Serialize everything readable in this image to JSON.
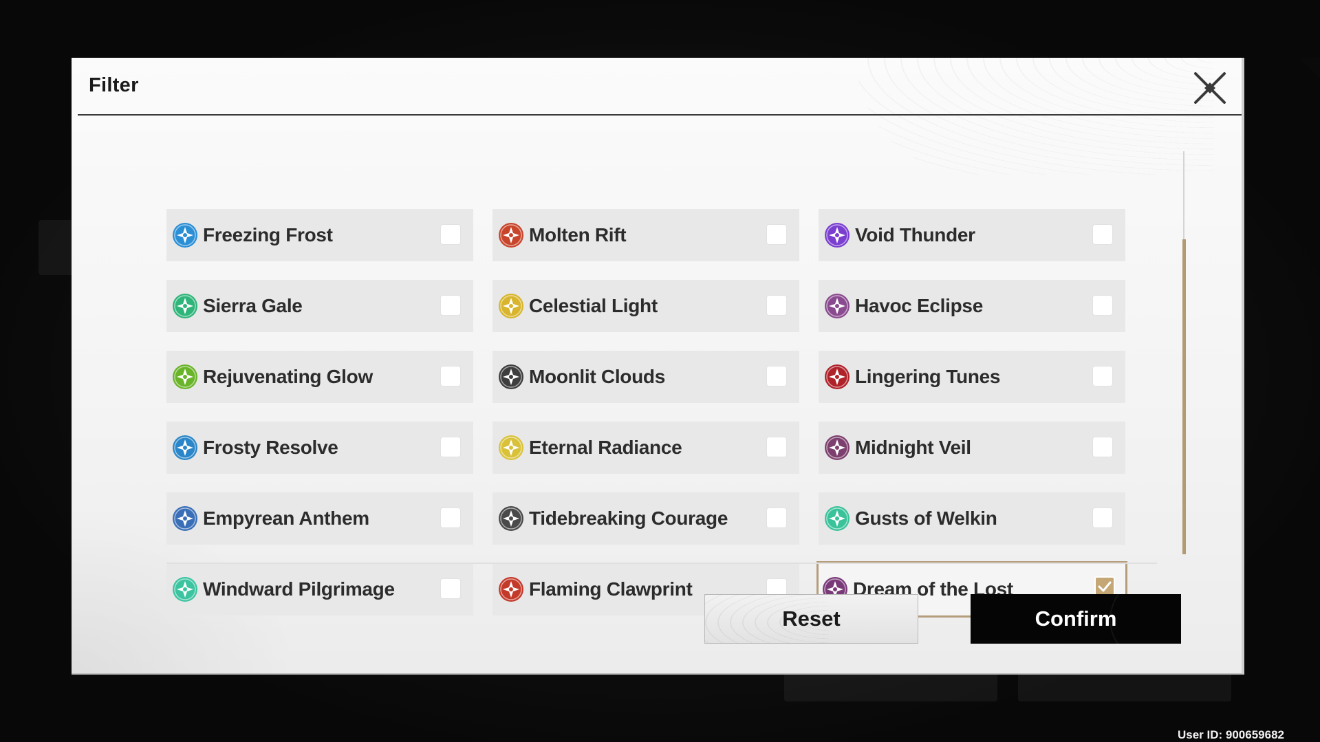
{
  "dialog": {
    "title": "Filter"
  },
  "items": [
    {
      "label": "Freezing Frost",
      "icon": "freezing-frost-icon",
      "color": "#2b8fd6",
      "checked": false
    },
    {
      "label": "Molten Rift",
      "icon": "molten-rift-icon",
      "color": "#c8452b",
      "checked": false
    },
    {
      "label": "Void Thunder",
      "icon": "void-thunder-icon",
      "color": "#7b3fd0",
      "checked": false
    },
    {
      "label": "Sierra Gale",
      "icon": "sierra-gale-icon",
      "color": "#2fb57a",
      "checked": false
    },
    {
      "label": "Celestial Light",
      "icon": "celestial-light-icon",
      "color": "#d8b52c",
      "checked": false
    },
    {
      "label": "Havoc Eclipse",
      "icon": "havoc-eclipse-icon",
      "color": "#8a4a8f",
      "checked": false
    },
    {
      "label": "Rejuvenating Glow",
      "icon": "rejuvenating-glow-icon",
      "color": "#6ab42a",
      "checked": false
    },
    {
      "label": "Moonlit Clouds",
      "icon": "moonlit-clouds-icon",
      "color": "#3e3e3e",
      "checked": false
    },
    {
      "label": "Lingering Tunes",
      "icon": "lingering-tunes-icon",
      "color": "#b0222a",
      "checked": false
    },
    {
      "label": "Frosty Resolve",
      "icon": "frosty-resolve-icon",
      "color": "#2a86c8",
      "checked": false
    },
    {
      "label": "Eternal Radiance",
      "icon": "eternal-radiance-icon",
      "color": "#d9c23a",
      "checked": false
    },
    {
      "label": "Midnight Veil",
      "icon": "midnight-veil-icon",
      "color": "#7d3f6e",
      "checked": false
    },
    {
      "label": "Empyrean Anthem",
      "icon": "empyrean-anthem-icon",
      "color": "#3a6fb8",
      "checked": false
    },
    {
      "label": "Tidebreaking Courage",
      "icon": "tidebreaking-courage-icon",
      "color": "#4a4a4a",
      "checked": false
    },
    {
      "label": "Gusts of Welkin",
      "icon": "gusts-of-welkin-icon",
      "color": "#3ac29a",
      "checked": false
    },
    {
      "label": "Windward Pilgrimage",
      "icon": "windward-pilgrimage-icon",
      "color": "#3cc4a0",
      "checked": false
    },
    {
      "label": "Flaming Clawprint",
      "icon": "flaming-clawprint-icon",
      "color": "#c43a2a",
      "checked": false
    },
    {
      "label": "Dream of the Lost",
      "icon": "dream-of-the-lost-icon",
      "color": "#7a3a78",
      "checked": true
    }
  ],
  "buttons": {
    "reset": "Reset",
    "confirm": "Confirm"
  },
  "footer": {
    "user_id": "User ID: 900659682"
  },
  "colors": {
    "accent": "#b59c7a",
    "check_fill": "#c5a776",
    "confirm_bg": "#050505"
  }
}
